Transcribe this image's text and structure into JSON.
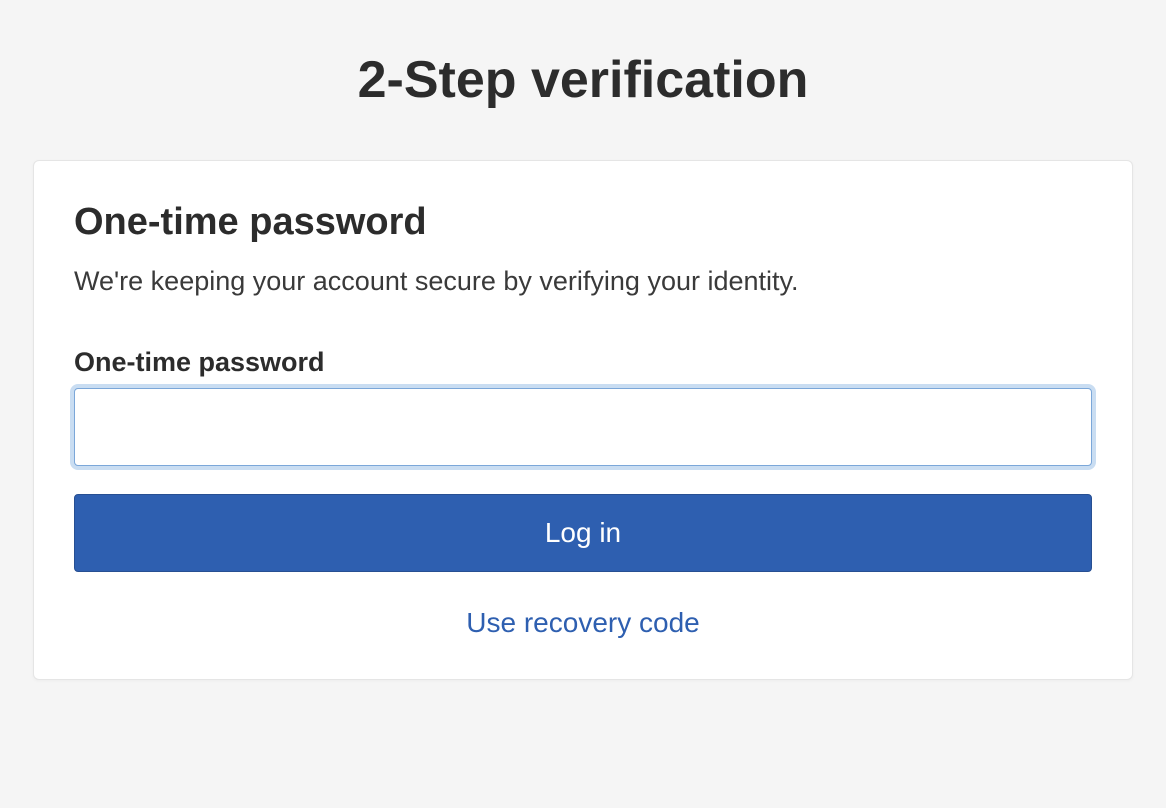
{
  "page": {
    "title": "2-Step verification"
  },
  "card": {
    "title": "One-time password",
    "description": "We're keeping your account secure by verifying your identity."
  },
  "form": {
    "otp_label": "One-time password",
    "otp_value": "",
    "login_button_label": "Log in",
    "recovery_link_label": "Use recovery code"
  }
}
